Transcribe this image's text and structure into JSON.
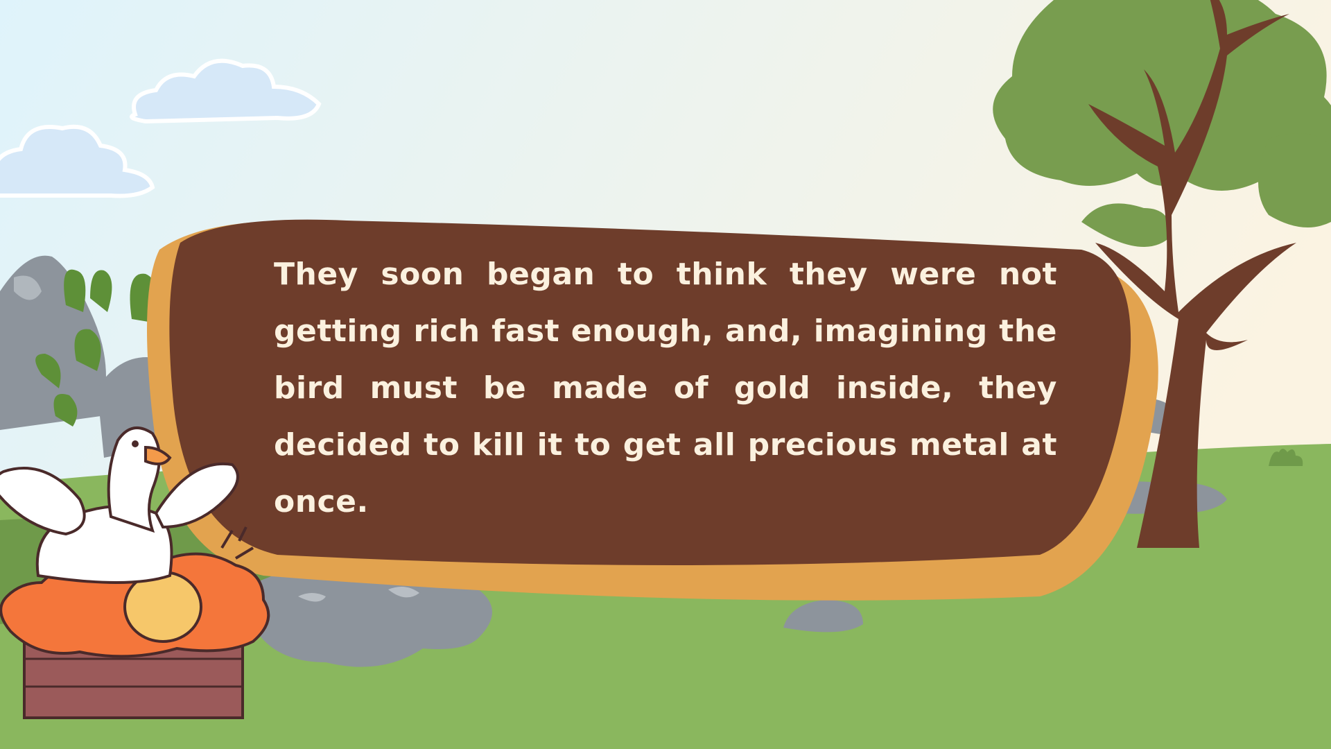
{
  "slide": {
    "story_text": "They soon began to think they were not getting rich fast enough, and, imagining the bird must be made of gold inside, they decided to kill it to get all precious metal at once."
  },
  "colors": {
    "sky_top": "#dff3fb",
    "sky_right": "#fbf3e2",
    "grass_light": "#8ab75e",
    "grass_dark": "#6f9a4a",
    "rock": "#8d949c",
    "bubble_fill": "#6e3d2b",
    "bubble_border": "#e2a34f",
    "text": "#fbf1df",
    "tree_trunk": "#6e3d2b",
    "tree_leaves": "#789d4f",
    "cloud": "#d6e8f8",
    "nest": "#f4763b",
    "crate": "#9b5a5a",
    "egg": "#f6c76a",
    "goose": "#ffffff",
    "goose_beak": "#f39a4a"
  },
  "icons": [
    "cloud-icon",
    "tree-icon",
    "rock-icon",
    "bush-icon",
    "goose-icon",
    "golden-egg-icon",
    "nest-icon",
    "crate-icon"
  ]
}
